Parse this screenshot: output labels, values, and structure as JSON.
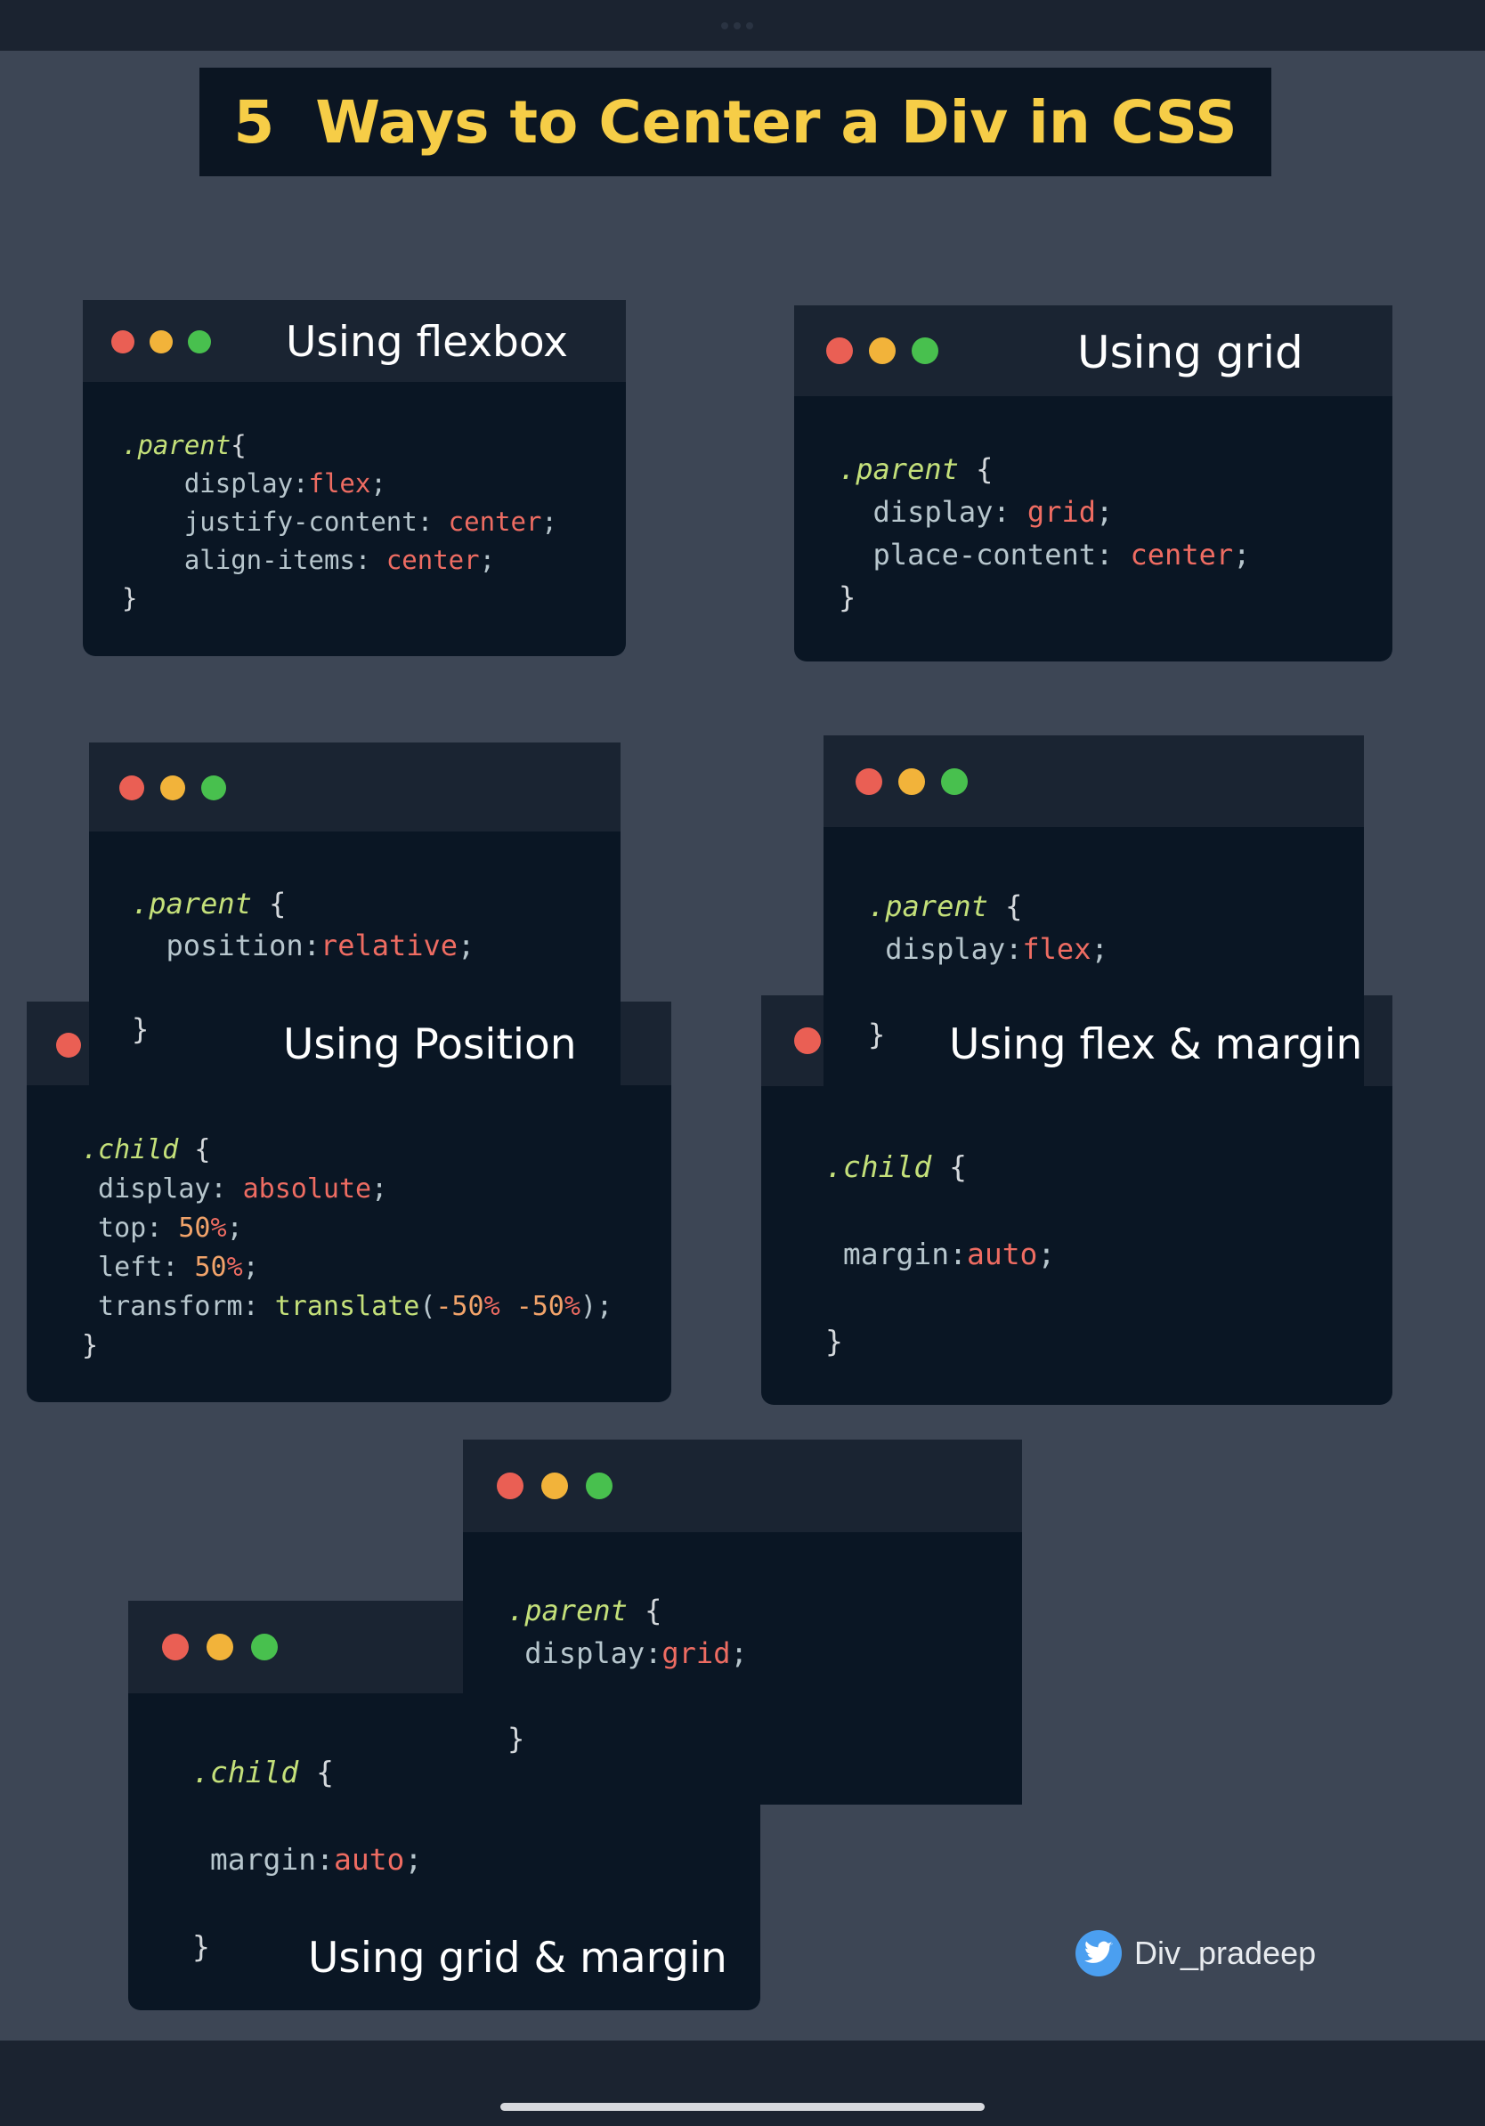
{
  "title": "5  Ways to Center a Div in CSS",
  "credit": {
    "handle": "Div_pradeep",
    "icon": "twitter-icon"
  },
  "colors": {
    "background": "#3d4655",
    "title_accent": "#f6cd47",
    "window_bg": "#0a1624",
    "window_bar": "#1a2432",
    "dot_red": "#ea5f54",
    "dot_yellow": "#f2b33a",
    "dot_green": "#48c04e",
    "code_selector": "#c4e07a",
    "code_value": "#ee6c62",
    "code_number": "#f1a36a",
    "code_text": "#b7c6cd"
  },
  "cards": {
    "flexbox": {
      "title": "Using flexbox",
      "code": [
        [
          [
            ".parent",
            "sel"
          ],
          [
            "{",
            "br"
          ]
        ],
        [
          [
            "    display:",
            "pr"
          ],
          [
            "flex",
            "val"
          ],
          [
            ";",
            "pr"
          ]
        ],
        [
          [
            "    justify-content: ",
            "pr"
          ],
          [
            "center",
            "val"
          ],
          [
            ";",
            "pr"
          ]
        ],
        [
          [
            "    align-items: ",
            "pr"
          ],
          [
            "center",
            "val"
          ],
          [
            ";",
            "pr"
          ]
        ],
        [
          [
            "}",
            "br"
          ]
        ]
      ]
    },
    "grid": {
      "title": "Using grid",
      "code": [
        [
          [
            ".parent",
            "sel"
          ],
          [
            " {",
            "br"
          ]
        ],
        [
          [
            "  display: ",
            "pr"
          ],
          [
            "grid",
            "val"
          ],
          [
            ";",
            "pr"
          ]
        ],
        [
          [
            "  place-content: ",
            "pr"
          ],
          [
            "center",
            "val"
          ],
          [
            ";",
            "pr"
          ]
        ],
        [
          [
            "}",
            "br"
          ]
        ]
      ]
    },
    "position": {
      "title": "Using Position",
      "parent_code": [
        [
          [
            ".parent",
            "sel"
          ],
          [
            " {",
            "br"
          ]
        ],
        [
          [
            "  position:",
            "pr"
          ],
          [
            "relative",
            "val"
          ],
          [
            ";",
            "pr"
          ]
        ],
        [
          [
            "",
            "pr"
          ]
        ],
        [
          [
            "}",
            "br"
          ]
        ]
      ],
      "child_code": [
        [
          [
            ".child",
            "sel"
          ],
          [
            " {",
            "br"
          ]
        ],
        [
          [
            " display: ",
            "pr"
          ],
          [
            "absolute",
            "val"
          ],
          [
            ";",
            "pr"
          ]
        ],
        [
          [
            " top: ",
            "pr"
          ],
          [
            "50",
            "num"
          ],
          [
            "%",
            "val"
          ],
          [
            ";",
            "pr"
          ]
        ],
        [
          [
            " left: ",
            "pr"
          ],
          [
            "50",
            "num"
          ],
          [
            "%",
            "val"
          ],
          [
            ";",
            "pr"
          ]
        ],
        [
          [
            " transform: ",
            "pr"
          ],
          [
            "translate",
            "fn"
          ],
          [
            "(",
            "pr"
          ],
          [
            "-50",
            "num"
          ],
          [
            "% ",
            "val"
          ],
          [
            "-50",
            "num"
          ],
          [
            "%",
            "val"
          ],
          [
            ");",
            "pr"
          ]
        ],
        [
          [
            "}",
            "br"
          ]
        ]
      ]
    },
    "flex_margin": {
      "title": "Using flex & margin",
      "parent_code": [
        [
          [
            ".parent",
            "sel"
          ],
          [
            " {",
            "br"
          ]
        ],
        [
          [
            " display:",
            "pr"
          ],
          [
            "flex",
            "val"
          ],
          [
            ";",
            "pr"
          ]
        ],
        [
          [
            "",
            "pr"
          ]
        ],
        [
          [
            "}",
            "br"
          ]
        ]
      ],
      "child_code": [
        [
          [
            ".child",
            "sel"
          ],
          [
            " {",
            "br"
          ]
        ],
        [
          [
            "",
            "pr"
          ]
        ],
        [
          [
            " margin:",
            "pr"
          ],
          [
            "auto",
            "val"
          ],
          [
            ";",
            "pr"
          ]
        ],
        [
          [
            "",
            "pr"
          ]
        ],
        [
          [
            "}",
            "br"
          ]
        ]
      ]
    },
    "grid_margin": {
      "title": "Using grid & margin",
      "parent_code": [
        [
          [
            ".parent",
            "sel"
          ],
          [
            " {",
            "br"
          ]
        ],
        [
          [
            " display:",
            "pr"
          ],
          [
            "grid",
            "val"
          ],
          [
            ";",
            "pr"
          ]
        ],
        [
          [
            "",
            "pr"
          ]
        ],
        [
          [
            "}",
            "br"
          ]
        ]
      ],
      "child_code": [
        [
          [
            ".child",
            "sel"
          ],
          [
            " {",
            "br"
          ]
        ],
        [
          [
            "",
            "pr"
          ]
        ],
        [
          [
            " margin:",
            "pr"
          ],
          [
            "auto",
            "val"
          ],
          [
            ";",
            "pr"
          ]
        ],
        [
          [
            "",
            "pr"
          ]
        ],
        [
          [
            "}",
            "br"
          ]
        ]
      ]
    }
  }
}
